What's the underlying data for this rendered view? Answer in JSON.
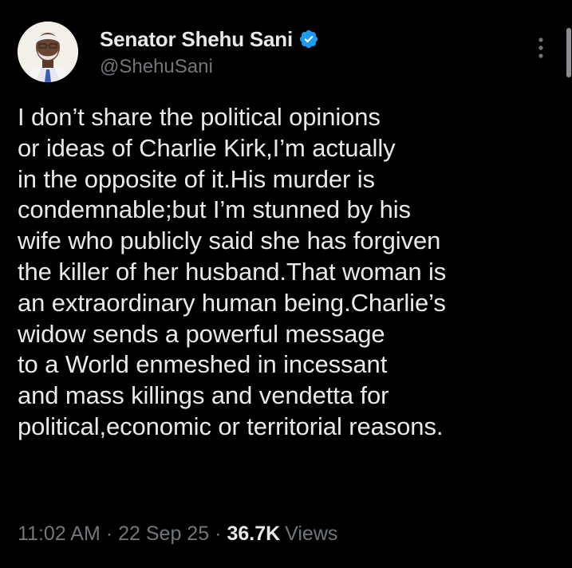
{
  "author": {
    "display_name": "Senator Shehu Sani",
    "handle": "@ShehuSani",
    "verified_badge_color": "#1d9bf0"
  },
  "tweet": {
    "lines": [
      "I don’t share the political opinions",
      "or ideas of Charlie Kirk,I’m actually",
      "in the opposite of it.His murder is",
      "condemnable;but I’m stunned by his",
      "wife who publicly said she has forgiven",
      "the killer of her husband.That woman is",
      "an extraordinary human being.Charlie’s",
      "widow sends a powerful message",
      "to a World enmeshed in incessant",
      "and mass killings and vendetta for",
      "political,economic or territorial reasons."
    ]
  },
  "meta": {
    "time": "11:02 AM",
    "separator": "·",
    "date": "22 Sep 25",
    "views_count": "36.7K",
    "views_label": "Views"
  },
  "icons": {
    "verified": "verified-badge-icon",
    "more": "more-options-icon"
  },
  "colors": {
    "background": "#000000",
    "text_primary": "#e7e9ea",
    "text_secondary": "#71767b"
  }
}
